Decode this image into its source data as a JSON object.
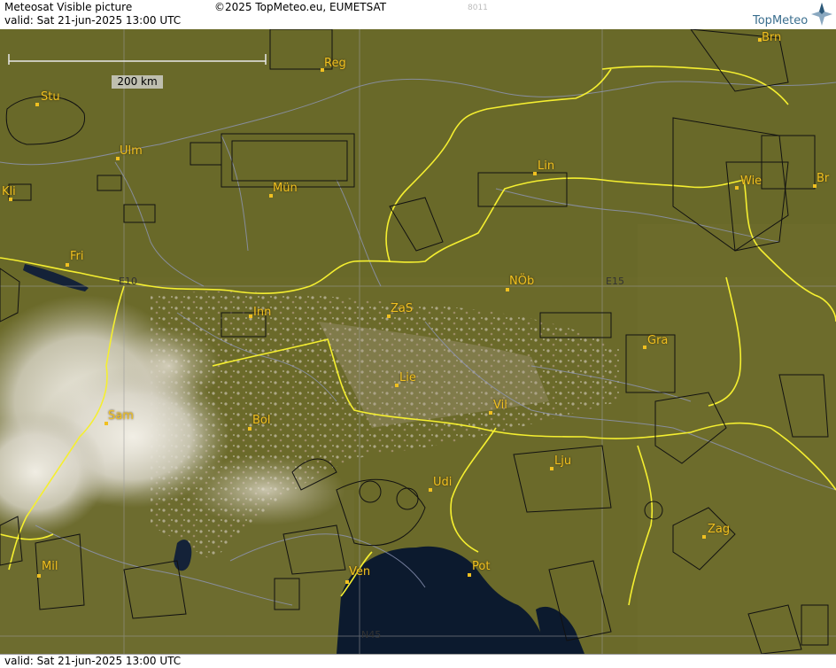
{
  "header": {
    "title": "Meteosat Visible picture",
    "valid": "valid:  Sat  21-jun-2025  13:00 UTC",
    "copyright": "©2025 TopMeteo.eu, EUMETSAT",
    "code": "8011",
    "logo_text": "TopMeteo"
  },
  "footer": {
    "valid": "valid:  Sat  21-jun-2025  13:00 UTC"
  },
  "scale": {
    "label": "200 km"
  },
  "grid_labels": {
    "e10": "E10",
    "e15": "E15",
    "n45": "N45"
  },
  "cities": {
    "brn": "Brn",
    "reg": "Reg",
    "stu": "Stu",
    "ulm": "Ulm",
    "mun": "Mün",
    "kli": "Kli",
    "lin": "Lin",
    "wie": "Wie",
    "br": "Br",
    "fri": "Fri",
    "nob": "NÖb",
    "inn": "Inn",
    "zas": "ZaS",
    "gra": "Gra",
    "lie": "Lie",
    "vil": "Vil",
    "sam": "Sam",
    "bol": "Bol",
    "lju": "Lju",
    "udi": "Udi",
    "zag": "Zag",
    "mil": "Mil",
    "ven": "Ven",
    "pot": "Pot"
  },
  "colors": {
    "land": "#6b6a2a",
    "sea": "#0c1a2e",
    "border": "#f5ef30",
    "city_label": "#f0c020"
  }
}
